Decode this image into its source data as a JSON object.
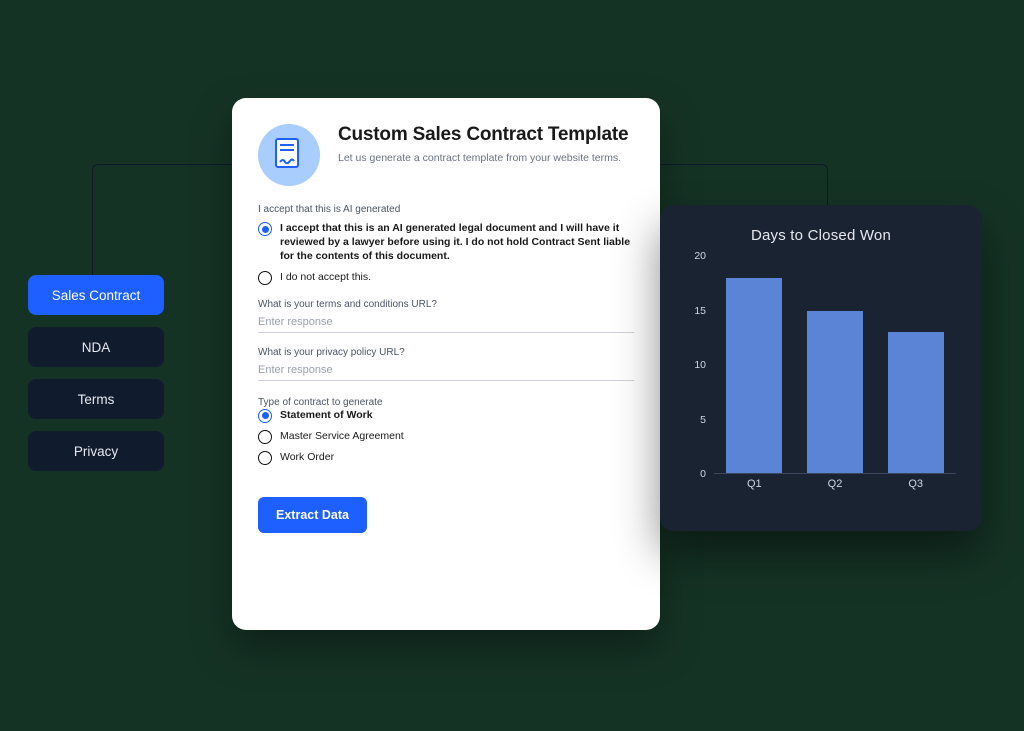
{
  "sidebar": {
    "items": [
      {
        "label": "Sales Contract",
        "active": true
      },
      {
        "label": "NDA",
        "active": false
      },
      {
        "label": "Terms",
        "active": false
      },
      {
        "label": "Privacy",
        "active": false
      }
    ]
  },
  "form": {
    "title": "Custom Sales Contract Template",
    "subtitle": "Let us generate a contract template from your website terms.",
    "accept_section_label": "I accept that this is AI generated",
    "accept_options": [
      {
        "label": "I accept that this is an AI generated legal document and I will have it reviewed by a lawyer before using it. I do not hold Contract Sent liable for the contents of this document.",
        "selected": true
      },
      {
        "label": "I do not accept this.",
        "selected": false
      }
    ],
    "terms_url": {
      "label": "What is your terms and conditions URL?",
      "placeholder": "Enter response",
      "value": ""
    },
    "privacy_url": {
      "label": "What is your privacy policy URL?",
      "placeholder": "Enter response",
      "value": ""
    },
    "contract_type_label": "Type of contract to generate",
    "contract_type_options": [
      {
        "label": "Statement of Work",
        "selected": true
      },
      {
        "label": "Master Service Agreement",
        "selected": false
      },
      {
        "label": "Work Order",
        "selected": false
      }
    ],
    "submit_label": "Extract Data",
    "icon_name": "document-signature-icon"
  },
  "chart_data": {
    "type": "bar",
    "title": "Days to Closed Won",
    "categories": [
      "Q1",
      "Q2",
      "Q3"
    ],
    "values": [
      18,
      15,
      13
    ],
    "ylabel": "",
    "xlabel": "",
    "ylim": [
      0,
      20
    ],
    "y_ticks": [
      0,
      5,
      10,
      15,
      20
    ],
    "bar_color": "#5b84d7",
    "bg_color": "#1a2332"
  }
}
